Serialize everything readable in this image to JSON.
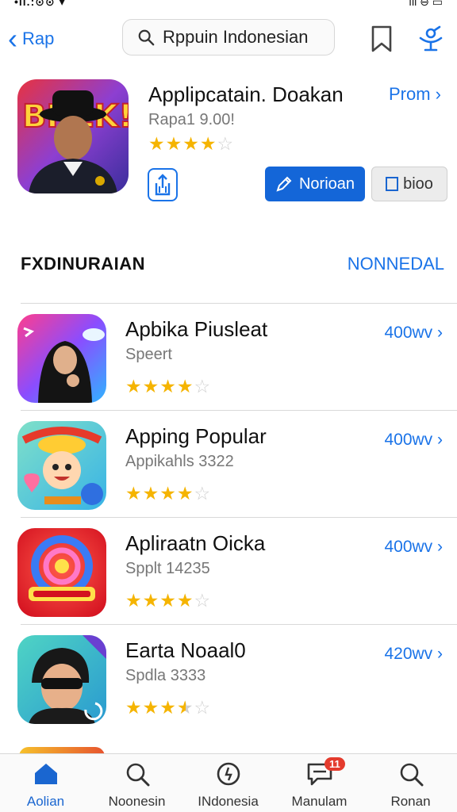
{
  "status_bar": {
    "left": "•ıl.:⊙⊙  ▾",
    "right": "ıll  ⊖  ▭"
  },
  "nav": {
    "back_label": "Rap",
    "search_text": "Rppuin Indonesian"
  },
  "hero": {
    "title": "Applipcatain. Doakan",
    "subtitle": "Rapa1 9.00!",
    "promo_label": "Prom ›",
    "rating_stars": 4,
    "primary_button": "Norioan",
    "secondary_button": "bioo"
  },
  "section": {
    "title": "FXDINURAIAN",
    "link": "NONNEDAL"
  },
  "apps": [
    {
      "name": "Apbika Piusleat",
      "subtitle": "Speert",
      "price": "400wv ›",
      "rating": 4
    },
    {
      "name": "Apping Popular",
      "subtitle": "Appikahls 3322",
      "price": "400wv ›",
      "rating": 4
    },
    {
      "name": "Apliraatn Oicka",
      "subtitle": "Spplt 14235",
      "price": "400wv ›",
      "rating": 4
    },
    {
      "name": "Earta Noaal0",
      "subtitle": "Spdla 3333",
      "price": "420wv ›",
      "rating": 3.5
    }
  ],
  "tabs": [
    {
      "label": "Aolian",
      "icon": "home-icon",
      "active": true
    },
    {
      "label": "Noonesin",
      "icon": "search-icon",
      "active": false
    },
    {
      "label": "INdonesia",
      "icon": "clock-icon",
      "active": false
    },
    {
      "label": "Manulam",
      "icon": "chat-icon",
      "active": false,
      "badge": "11"
    },
    {
      "label": "Ronan",
      "icon": "search-icon",
      "active": false
    }
  ],
  "colors": {
    "accent": "#1a73e8",
    "primary_button": "#1466d8",
    "star": "#f5b400",
    "badge": "#e43b2d"
  }
}
